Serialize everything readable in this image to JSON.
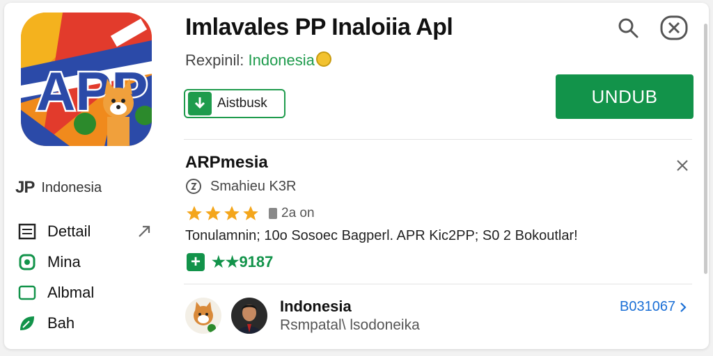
{
  "header": {
    "title": "Imlavales PP Inaloiia Apl",
    "subtitle_prefix": "Rexpinil: ",
    "subtitle_country": "Indonesia",
    "add_label": "Aistbusk",
    "install_label": "UNDUB",
    "icons": {
      "search": "search-icon",
      "close": "close-circle-icon",
      "add": "download-icon"
    }
  },
  "app_icon": {
    "text": "APP"
  },
  "sidebar": {
    "developer_logo": "JP",
    "developer_name": "Indonesia",
    "items": [
      {
        "label": "Dettail",
        "icon": "document-list-icon"
      },
      {
        "label": "Mina",
        "icon": "share-icon"
      },
      {
        "label": "Albmal",
        "icon": "tablet-icon"
      },
      {
        "label": "Bah",
        "icon": "leaf-icon"
      }
    ]
  },
  "details": {
    "title": "ARPmesia",
    "meta": "Smahieu K3R",
    "rating_count": "2a on",
    "stars": 4,
    "description": "Tonulamnin; 10o Sosoec Bagperl. APR Kic2PP; S0 2 Bokoutlar!",
    "tag_text": "★★9187"
  },
  "user": {
    "name": "Indonesia",
    "subtitle": "Rsmpatal\\ lsodoneika",
    "link": "B031067"
  },
  "colors": {
    "green": "#12934a",
    "blue": "#1a6fd6",
    "star": "#f4a61c"
  }
}
